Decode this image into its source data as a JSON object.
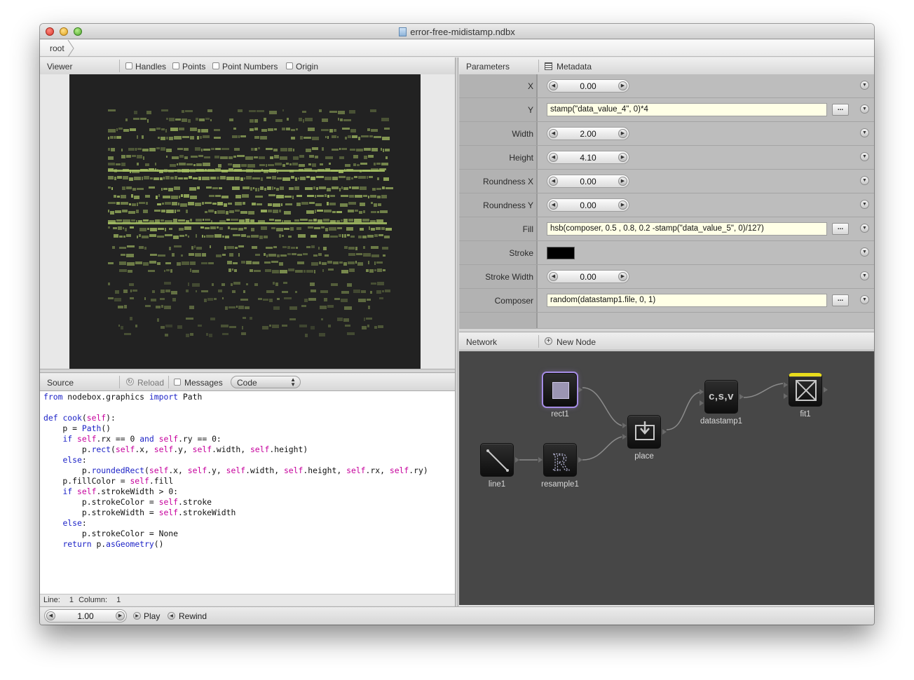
{
  "window": {
    "title": "error-free-midistamp.ndbx",
    "breadcrumb": [
      "root"
    ]
  },
  "viewer": {
    "title": "Viewer",
    "options": [
      "Handles",
      "Points",
      "Point Numbers",
      "Origin"
    ]
  },
  "source": {
    "title": "Source",
    "reload_label": "Reload",
    "messages_label": "Messages",
    "mode": "Code",
    "status_line_label": "Line:",
    "line": "1",
    "status_column_label": "Column:",
    "column": "1"
  },
  "parameters": {
    "title": "Parameters",
    "metadata_label": "Metadata",
    "rows": [
      {
        "label": "X",
        "type": "number",
        "value": "0.00"
      },
      {
        "label": "Y",
        "type": "expression",
        "value": "stamp(\"data_value_4\", 0)*4"
      },
      {
        "label": "Width",
        "type": "number",
        "value": "2.00"
      },
      {
        "label": "Height",
        "type": "number",
        "value": "4.10"
      },
      {
        "label": "Roundness X",
        "type": "number",
        "value": "0.00"
      },
      {
        "label": "Roundness Y",
        "type": "number",
        "value": "0.00"
      },
      {
        "label": "Fill",
        "type": "expression",
        "value": "hsb(composer, 0.5 , 0.8, 0.2 -stamp(\"data_value_5\", 0)/127)"
      },
      {
        "label": "Stroke",
        "type": "color",
        "value": "#000000"
      },
      {
        "label": "Stroke Width",
        "type": "number",
        "value": "0.00"
      },
      {
        "label": "Composer",
        "type": "expression",
        "value": "random(datastamp1.file, 0, 1)"
      }
    ],
    "dots_label": "..."
  },
  "network": {
    "title": "Network",
    "new_node_label": "New Node",
    "nodes": {
      "rect1": "rect1",
      "line1": "line1",
      "resample1": "resample1",
      "place": "place",
      "datastamp1": "datastamp1",
      "datastamp1_icon_text": "c,s,v",
      "fit1": "fit1"
    }
  },
  "playback": {
    "frame": "1.00",
    "play_label": "Play",
    "rewind_label": "Rewind"
  },
  "colors": {
    "canvas_bg": "#222222",
    "stamp_color": "#a9c465",
    "network_bg": "#474747",
    "selected_glow": "#a68de6",
    "rendered_flag": "#e9dd1c"
  }
}
